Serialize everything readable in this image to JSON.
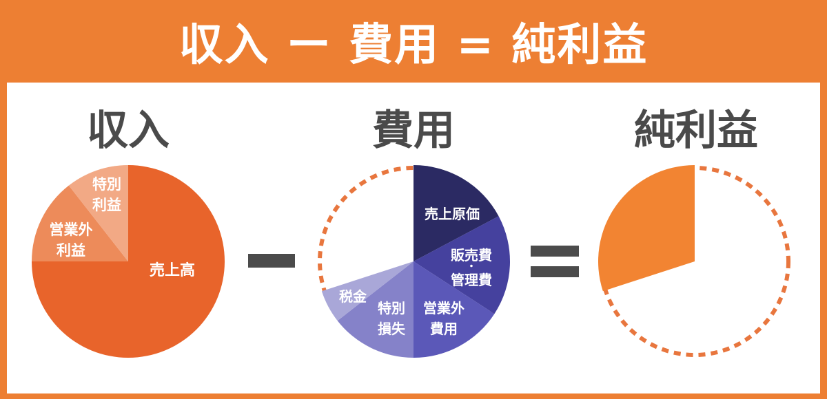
{
  "header": {
    "title": "収入 ー 費用 = 純利益"
  },
  "columns": {
    "income": {
      "title": "収入"
    },
    "expense": {
      "title": "費用"
    },
    "net_profit": {
      "title": "純利益"
    }
  },
  "labels": {
    "income_sales": "売上高",
    "income_nonop_1": "営業外",
    "income_nonop_2": "利益",
    "income_special_1": "特別",
    "income_special_2": "利益",
    "exp_cogs": "売上原価",
    "exp_sga_1": "販売費",
    "exp_sga_2": "・",
    "exp_sga_3": "管理費",
    "exp_nonop_1": "営業外",
    "exp_nonop_2": "費用",
    "exp_special_1": "特別",
    "exp_special_2": "損失",
    "exp_tax": "税金"
  },
  "operators": {
    "minus": "minus",
    "equals": "equals"
  },
  "colors": {
    "header_bg": "#ED7F33",
    "title_text": "#4A4A4A",
    "income_sales": "#E8642B",
    "income_nonop": "#ED8B5A",
    "income_special": "#F2A985",
    "exp_cogs": "#2B2A63",
    "exp_sga": "#45419E",
    "exp_nonop": "#5B58B8",
    "exp_special": "#8582C9",
    "exp_tax": "#A9A7D8",
    "profit": "#F28432",
    "dotted_outline": "#E8763E"
  }
}
